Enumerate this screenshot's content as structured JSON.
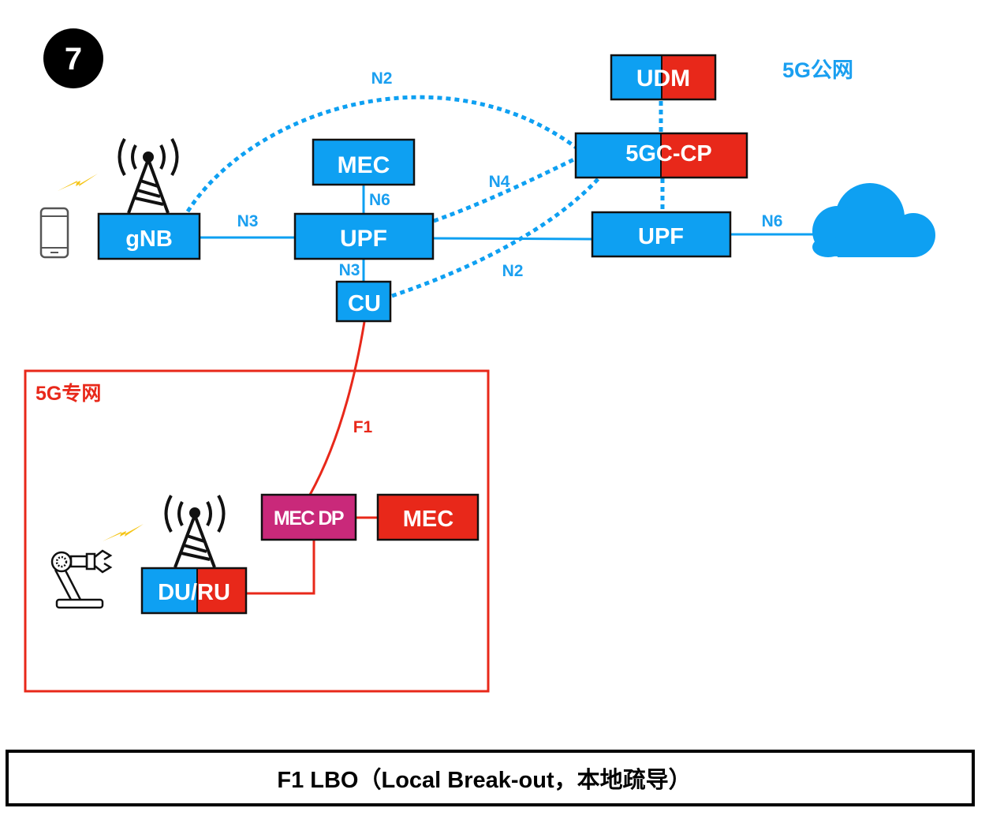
{
  "badge": {
    "number": "7"
  },
  "colors": {
    "public": "#0ea0f2",
    "private": "#e8281a",
    "mec_dp": "#c9297a",
    "bolt": "#f5c518",
    "border": "#111111"
  },
  "regions": {
    "public_label": "5G公网",
    "private_label": "5G专网"
  },
  "nodes": {
    "udm": "UDM",
    "cp": "5GC-CP",
    "gnb": "gNB",
    "mec_public": "MEC",
    "upf_local": "UPF",
    "upf_central": "UPF",
    "cu": "CU",
    "mec_dp": "MEC DP",
    "mec_private": "MEC",
    "du_ru": "DU/RU"
  },
  "interfaces": {
    "n2_top": "N2",
    "n3_gnb_upf": "N3",
    "n6_mec": "N6",
    "n4": "N4",
    "n3_upf_cu": "N3",
    "n2_cu": "N2",
    "n6_cloud": "N6",
    "f1": "F1"
  },
  "icons": {
    "phone": "smartphone-icon",
    "tower": "cell-tower-icon",
    "bolt": "lightning-bolt-icon",
    "cloud": "cloud-icon",
    "robot": "robot-arm-icon"
  },
  "caption": "F1 LBO（Local Break-out，本地疏导）"
}
